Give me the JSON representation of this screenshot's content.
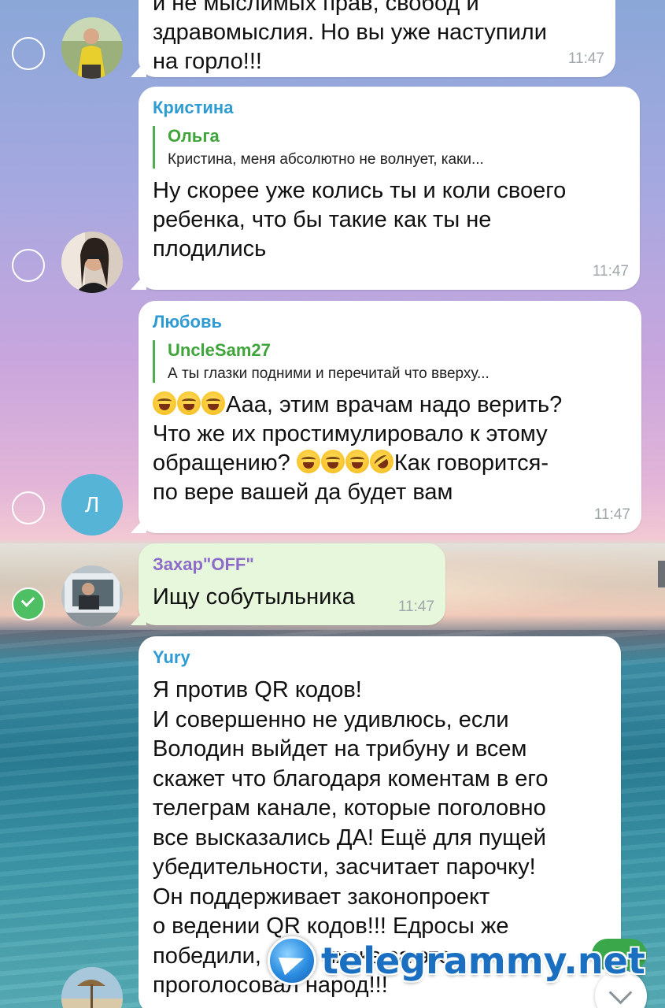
{
  "messages": [
    {
      "id": "m1",
      "sender": "",
      "text": "и не мыслимых прав, свобод и\nздравомыслия. Но вы уже наступили\nна горло!!!",
      "time": "11:47",
      "selected": false,
      "avatar": "photo"
    },
    {
      "id": "m2",
      "sender": "Кристина",
      "sender_color": "#2f9bd3",
      "reply_name": "Ольга",
      "reply_text": "Кристина,  меня абсолютно не волнует, каки...",
      "text": "Ну скорее уже колись ты и коли своего\nребенка, что бы такие как ты не\nплодились",
      "time": "11:47",
      "selected": false,
      "avatar": "photo"
    },
    {
      "id": "m3",
      "sender": "Любовь",
      "sender_color": "#2f9bd3",
      "reply_name": "UncleSam27",
      "reply_text": "А ты глазки подними и перечитай что вверху...",
      "text_part1": "Ааа, этим врачам надо верить?\nЧто же их простимулировало к этому\nобращению? ",
      "text_part2": "Как говорится-\nпо вере вашей да будет вам",
      "time": "11:47",
      "selected": false,
      "avatar_letter": "Л"
    },
    {
      "id": "m4",
      "sender": "Захар\"OFF\"",
      "sender_color": "#8e6bc9",
      "text": "Ищу собутыльника",
      "time": "11:47",
      "selected": true,
      "avatar": "photo"
    },
    {
      "id": "m5",
      "sender": "Yury",
      "sender_color": "#2f9bd3",
      "text": "Я против QR кодов!\nИ совершенно не удивлюсь, если\nВолодин выйдет на трибуну и всем\nскажет что благодаря коментам в его\nтелеграм канале, которые поголовно\nвсе высказались  ДА! Ещё для пущей\nубедительности, засчитает парочку!\nОн поддерживает законопроект\nо  ведении QR кодов!!! Едросы же\nпобедили, ведь их же за это\nпроголосовал народ!!!",
      "selected": false,
      "avatar": "photo"
    }
  ],
  "watermark": {
    "text": "telegrammy.net"
  },
  "icons": {
    "select": "selection-circle-icon",
    "checked": "checkmark-icon",
    "scroll_down": "chevron-down-icon",
    "emoji_laugh": "face-with-tears-of-joy",
    "emoji_rofl": "rolling-on-floor-laughing"
  }
}
